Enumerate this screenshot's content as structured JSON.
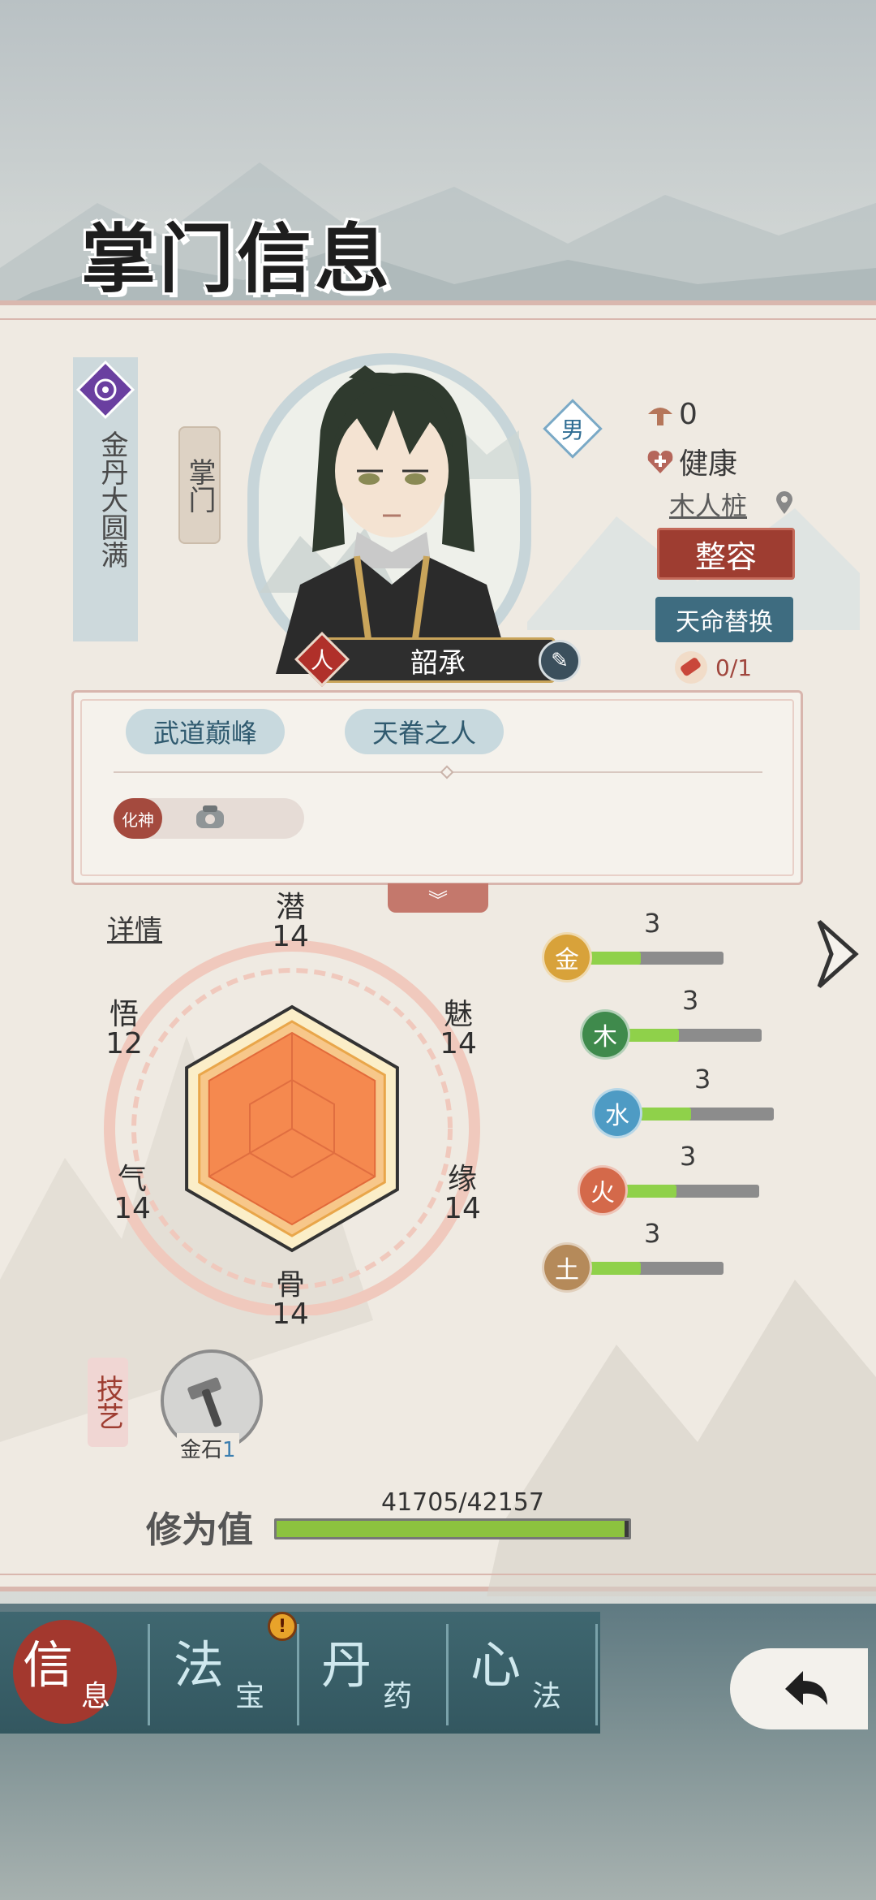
{
  "page": {
    "title": "掌门信息"
  },
  "profile": {
    "realm": "金丹大圆满",
    "role": "掌门",
    "name": "韶承",
    "gender": "男",
    "ren_tag": "人",
    "coin_count": "0",
    "health": "健康",
    "location": "木人桩",
    "zhengrong_label": "整容",
    "tianming_label": "天命替换",
    "tianming_count": "0/1"
  },
  "traits": {
    "items": [
      "武道巅峰",
      "天眷之人"
    ],
    "huashen_badge": "化神"
  },
  "attributes": {
    "detail_label": "详情",
    "qian": {
      "label": "潜",
      "value": "14"
    },
    "mei": {
      "label": "魅",
      "value": "14"
    },
    "yuan": {
      "label": "缘",
      "value": "14"
    },
    "gu": {
      "label": "骨",
      "value": "14"
    },
    "qi": {
      "label": "气",
      "value": "14"
    },
    "wu": {
      "label": "悟",
      "value": "12"
    }
  },
  "elements": [
    {
      "name": "金",
      "value": "3",
      "color": "#d8a23a",
      "fill": 0.4
    },
    {
      "name": "木",
      "value": "3",
      "color": "#3f8a4c",
      "fill": 0.4
    },
    {
      "name": "水",
      "value": "3",
      "color": "#4e9bc4",
      "fill": 0.4
    },
    {
      "name": "火",
      "value": "3",
      "color": "#d4694a",
      "fill": 0.4
    },
    {
      "name": "土",
      "value": "3",
      "color": "#b58a5a",
      "fill": 0.4
    }
  ],
  "skills": {
    "section_label": "技艺",
    "items": [
      {
        "name": "金石",
        "level": "1"
      }
    ]
  },
  "cultivation": {
    "label": "修为值",
    "current": 41705,
    "max": 42157,
    "display": "41705/42157"
  },
  "nav": {
    "tabs": [
      {
        "big": "信",
        "small": "息"
      },
      {
        "big": "法",
        "small": "宝"
      },
      {
        "big": "丹",
        "small": "药"
      },
      {
        "big": "心",
        "small": "法"
      }
    ],
    "alert": "!"
  },
  "colors": {
    "accent_red": "#9e3d31",
    "accent_blue": "#3e6c80",
    "panel": "#efeae2"
  }
}
